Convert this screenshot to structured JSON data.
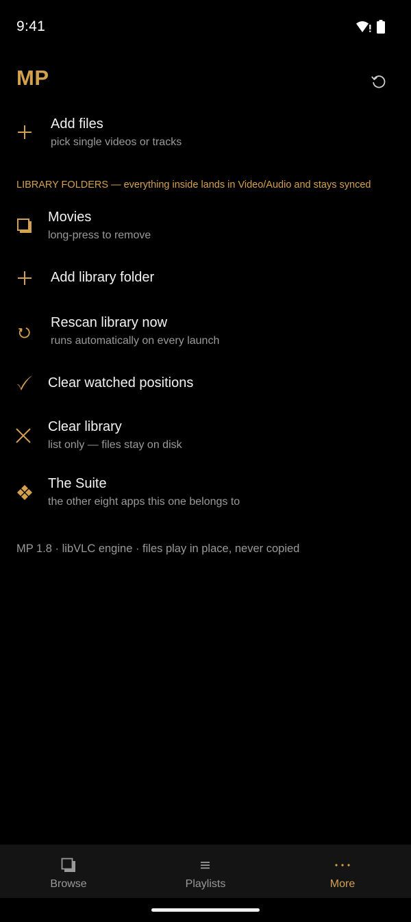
{
  "status_bar": {
    "time": "9:41",
    "icons": [
      "wifi-alert-icon",
      "battery-icon"
    ]
  },
  "header": {
    "title": "MP",
    "refresh_icon": "refresh-icon"
  },
  "add_files": {
    "title": "Add files",
    "subtitle": "pick single videos or tracks",
    "icon": "plus-icon"
  },
  "library_section": {
    "label": "LIBRARY FOLDERS — everything inside lands in Video/Audio and stays synced"
  },
  "folders": [
    {
      "title": "Movies",
      "subtitle": "long-press to remove",
      "icon": "folder-icon"
    }
  ],
  "actions": {
    "add_folder": {
      "title": "Add library folder",
      "icon": "plus-icon"
    },
    "rescan": {
      "title": "Rescan library now",
      "subtitle": "runs automatically on every launch",
      "icon": "rescan-icon"
    },
    "clear_watched": {
      "title": "Clear watched positions",
      "icon": "checkmark-icon"
    },
    "clear_library": {
      "title": "Clear library",
      "subtitle": "list only — files stay on disk",
      "icon": "close-icon"
    },
    "suite": {
      "title": "The Suite",
      "subtitle": "the other eight apps this one belongs to",
      "icon": "diamond-cluster-icon"
    }
  },
  "footer_note": "MP 1.8 · libVLC engine · files play in place, never copied",
  "bottom_nav": {
    "items": [
      {
        "label": "Browse",
        "icon": "browse-icon",
        "active": false
      },
      {
        "label": "Playlists",
        "icon": "list-icon",
        "active": false
      },
      {
        "label": "More",
        "icon": "more-icon",
        "active": true
      }
    ]
  },
  "colors": {
    "accent": "#d4a24e",
    "background": "#000000",
    "nav_background": "#141414",
    "primary_text": "#f2f2f2",
    "secondary_text": "#9a9a9a"
  }
}
